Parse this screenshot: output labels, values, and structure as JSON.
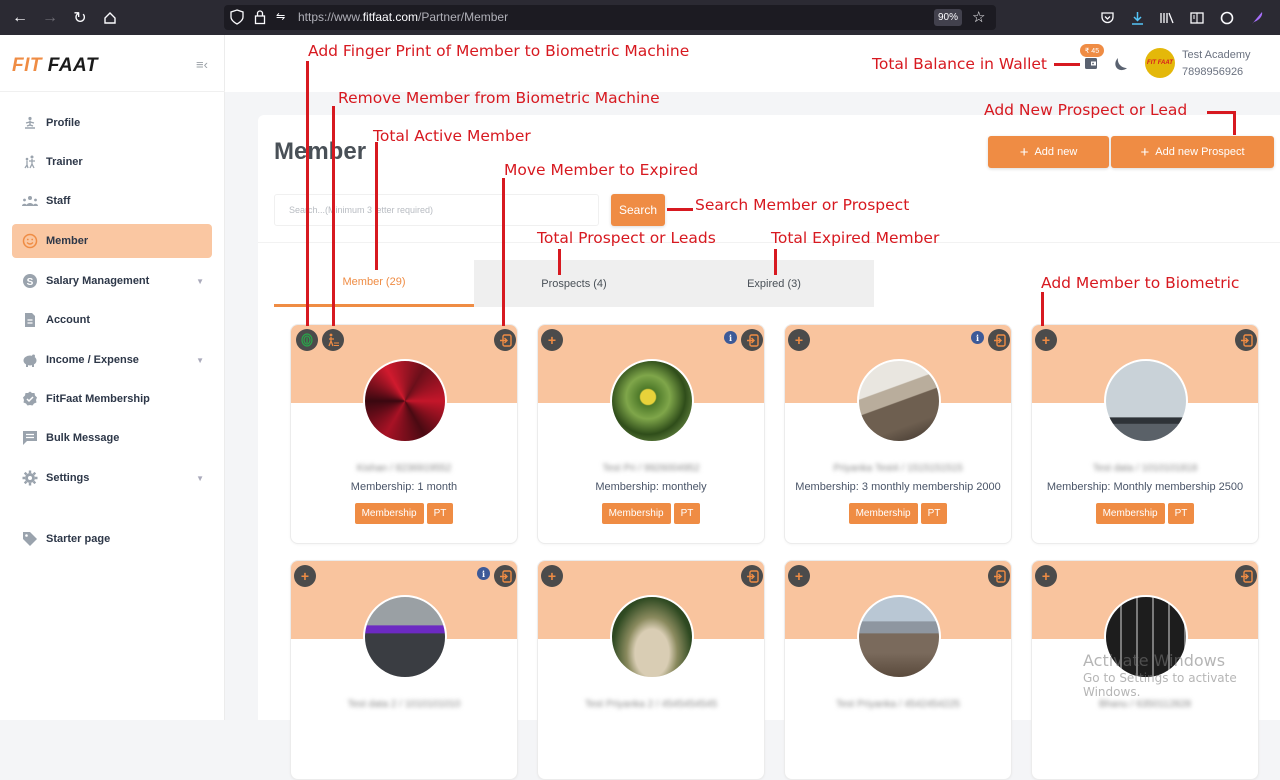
{
  "browser": {
    "url_prefix": "https://www.",
    "url_domain": "fitfaat.com",
    "url_path": "/Partner/Member",
    "zoom": "90%"
  },
  "sidebar": {
    "logo_fit": "FIT",
    "logo_faat": "FAAT",
    "items": [
      {
        "label": "Profile",
        "icon": "yoga-icon",
        "active": false
      },
      {
        "label": "Trainer",
        "icon": "trainer-icon",
        "active": false
      },
      {
        "label": "Staff",
        "icon": "staff-icon",
        "active": false
      },
      {
        "label": "Member",
        "icon": "smile-icon",
        "active": true
      },
      {
        "label": "Salary Management",
        "icon": "dollar-icon",
        "active": false,
        "expandable": true
      },
      {
        "label": "Account",
        "icon": "document-icon",
        "active": false
      },
      {
        "label": "Income / Expense",
        "icon": "piggy-bank-icon",
        "active": false,
        "expandable": true
      },
      {
        "label": "FitFaat Membership",
        "icon": "badge-check-icon",
        "active": false
      },
      {
        "label": "Bulk Message",
        "icon": "message-icon",
        "active": false
      },
      {
        "label": "Settings",
        "icon": "gear-icon",
        "active": false,
        "expandable": true
      },
      {
        "label": "Starter page",
        "icon": "tag-icon",
        "active": false
      }
    ]
  },
  "header": {
    "wallet_balance": "₹ 45",
    "account_name": "Test Academy",
    "account_phone": "7898956926",
    "avatar_text": "FIT FAAT"
  },
  "main": {
    "title": "Member",
    "add_new_label": "Add new",
    "add_prospect_label": "Add new Prospect",
    "search_placeholder": "Search...(Minimum 3 letter required)",
    "search_button": "Search",
    "tabs": [
      {
        "label": "Member (29)",
        "active": true
      },
      {
        "label": "Prospects (4)",
        "active": false
      },
      {
        "label": "Expired (3)",
        "active": false
      }
    ],
    "members": [
      {
        "name": "Kishan / 8236919552",
        "plan": "Membership: 1 month",
        "biometric": true,
        "info": false
      },
      {
        "name": "Test Pri / 9926004952",
        "plan": "Membership: monthely",
        "biometric": false,
        "info": true
      },
      {
        "name": "Priyanka Test4 / 1515151515",
        "plan": "Membership: 3 monthly membership 2000",
        "biometric": false,
        "info": true
      },
      {
        "name": "Test data / 1010101818",
        "plan": "Membership: Monthly membership 2500",
        "biometric": false,
        "info": false
      },
      {
        "name": "Test data 2 / 1010101010",
        "plan": "",
        "biometric": false,
        "info": true
      },
      {
        "name": "Test Priyanka 2 / 4545454545",
        "plan": "",
        "biometric": false,
        "info": false
      },
      {
        "name": "Test Priyanka / 4542454225",
        "plan": "",
        "biometric": false,
        "info": false
      },
      {
        "name": "Bhanu / 6350112828",
        "plan": "",
        "biometric": false,
        "info": false
      }
    ],
    "card_button_membership": "Membership",
    "card_button_pt": "PT"
  },
  "annotations": {
    "fingerprint": "Add Finger Print of Member to Biometric Machine",
    "remove_bio": "Remove Member from Biometric Machine",
    "active": "Total Active Member",
    "expire": "Move Member to Expired",
    "search": "Search Member or Prospect",
    "prospects": "Total Prospect or Leads",
    "expired": "Total Expired Member",
    "add_bio": "Add Member to Biometric",
    "wallet": "Total Balance in Wallet",
    "add_prospect": "Add New Prospect or Lead"
  },
  "watermark": {
    "line1": "Activate Windows",
    "line2": "Go to Settings to activate Windows."
  }
}
